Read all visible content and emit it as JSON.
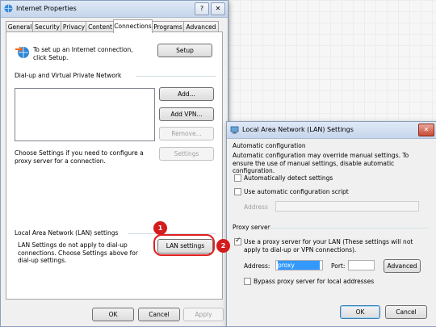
{
  "main_window": {
    "title": "Internet Properties",
    "help_btn": "?",
    "close_btn": "✕",
    "tabs": [
      "General",
      "Security",
      "Privacy",
      "Content",
      "Connections",
      "Programs",
      "Advanced"
    ],
    "active_tab": "Connections",
    "setup_text": "To set up an Internet connection, click Setup.",
    "setup_button": "Setup",
    "dialup_heading": "Dial-up and Virtual Private Network",
    "add_button": "Add...",
    "add_vpn_button": "Add VPN...",
    "remove_button": "Remove...",
    "settings_text": "Choose Settings if you need to configure a proxy server for a connection.",
    "settings_button": "Settings",
    "lan_heading": "Local Area Network (LAN) settings",
    "lan_text": "LAN Settings do not apply to dial-up connections. Choose Settings above for dial-up settings.",
    "lan_settings_button": "LAN settings",
    "ok_button": "OK",
    "cancel_button": "Cancel",
    "apply_button": "Apply"
  },
  "badges": {
    "one": "1",
    "two": "2"
  },
  "lan_window": {
    "title": "Local Area Network (LAN) Settings",
    "close_btn": "✕",
    "auto_heading": "Automatic configuration",
    "auto_text": "Automatic configuration may override manual settings. To ensure the use of manual settings, disable automatic configuration.",
    "auto_detect": "Automatically detect settings",
    "use_script": "Use automatic configuration script",
    "address_label": "Address",
    "proxy_heading": "Proxy server",
    "use_proxy": "Use a proxy server for your LAN (These settings will not apply to dial-up or VPN connections).",
    "proxy_address_label": "Address:",
    "proxy_address_value": "proxy",
    "port_label": "Port:",
    "advanced_button": "Advanced",
    "bypass_label": "Bypass proxy server for local addresses",
    "ok_button": "OK",
    "cancel_button": "Cancel"
  },
  "colors": {
    "badge": "#d41c1c",
    "selection": "#3399ff"
  }
}
